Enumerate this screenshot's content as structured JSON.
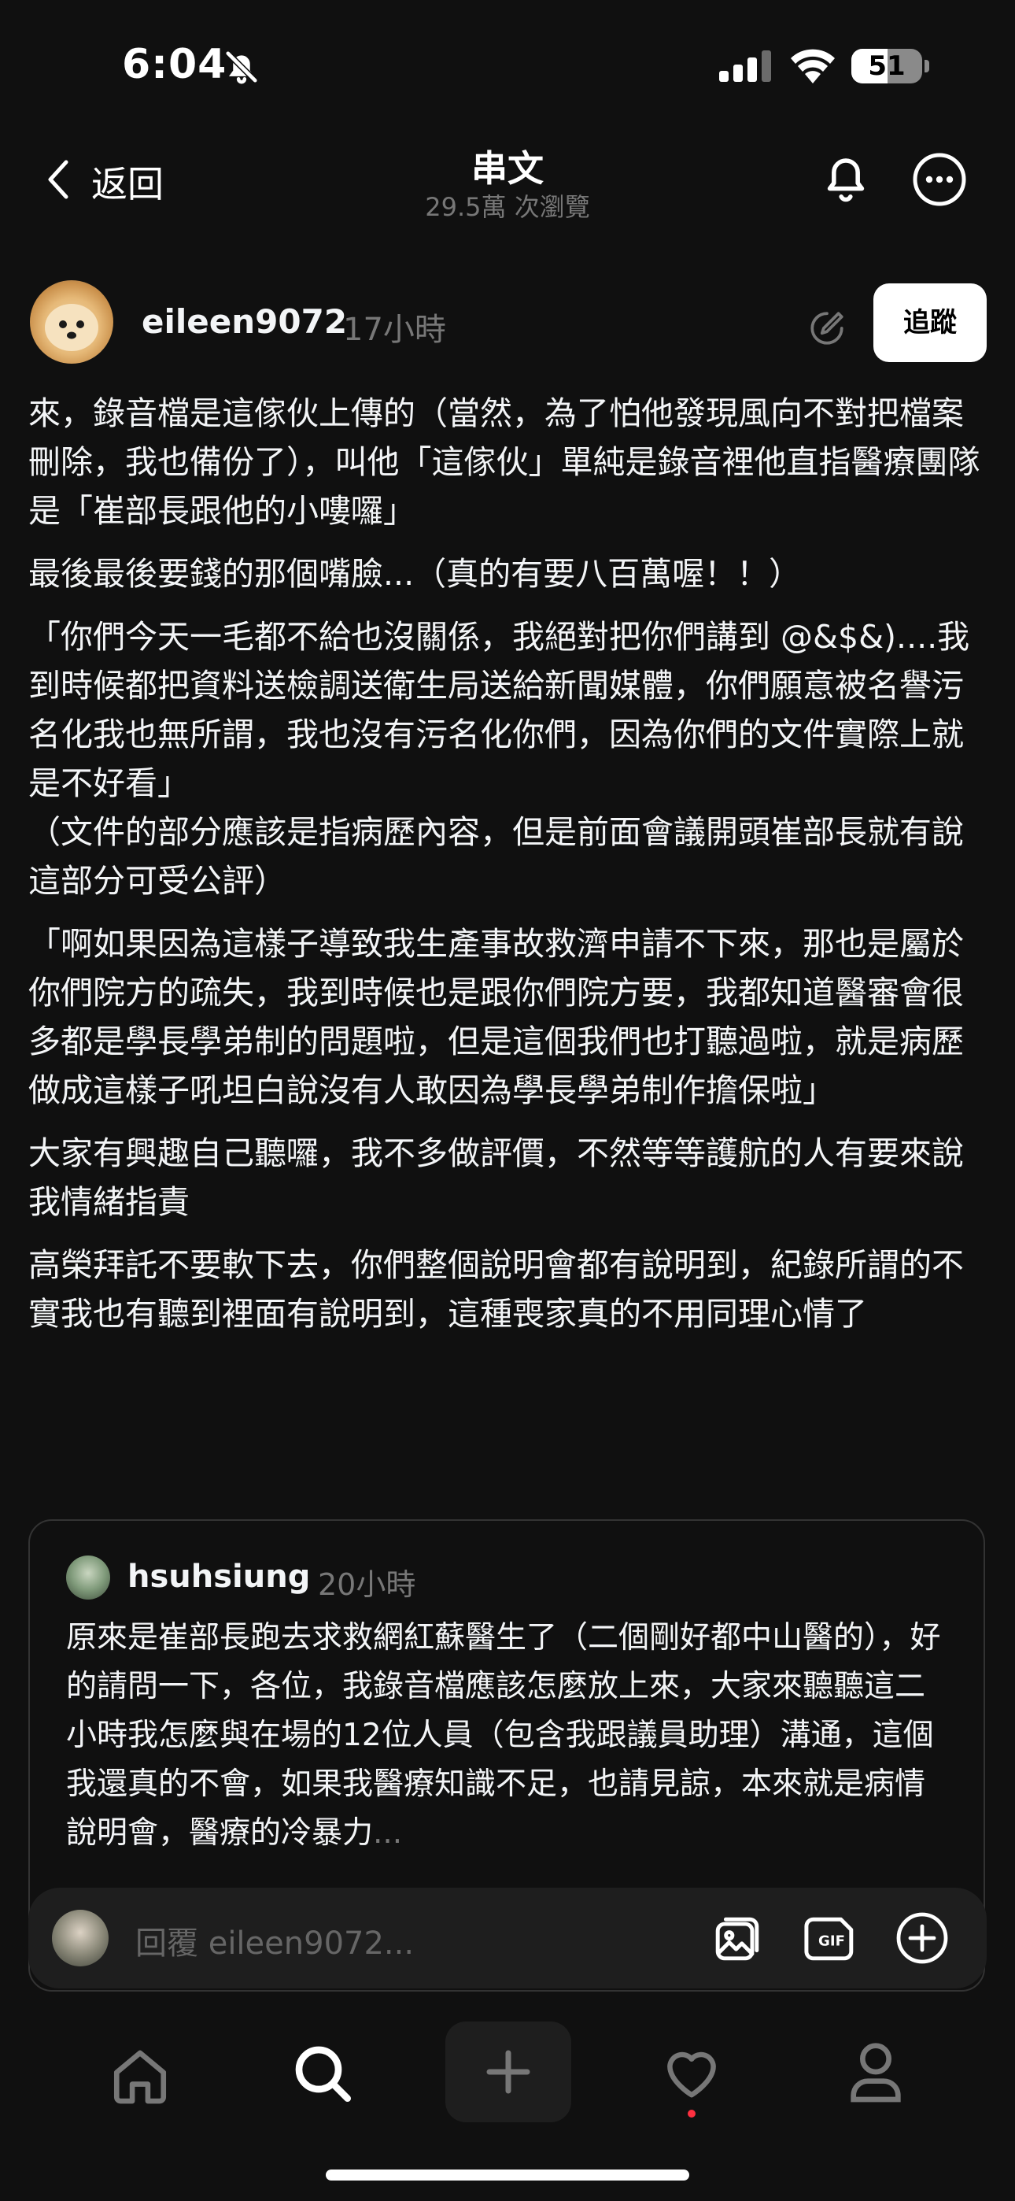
{
  "status_bar": {
    "time": "6:04",
    "battery": "51",
    "battery_fraction": 0.51,
    "icons": [
      "bell-slash-icon",
      "signal-icon",
      "wifi-icon",
      "battery-icon"
    ]
  },
  "header": {
    "back_label": "返回",
    "title": "串文",
    "subtitle": "29.5萬 次瀏覽",
    "icons": [
      "chevron-left-icon",
      "bell-icon",
      "more-icon"
    ]
  },
  "post": {
    "username": "eileen9072",
    "time": "17小時",
    "follow_label": "追蹤",
    "paragraphs": [
      "來，錄音檔是這傢伙上傳的（當然，為了怕他發現風向不對把檔案刪除，我也備份了），叫他「這傢伙」單純是錄音裡他直指醫療團隊是「崔部長跟他的小嘍囉」",
      "最後最後要錢的那個嘴臉...（真的有要八百萬喔！！）",
      "「你們今天一毛都不給也沒關係，我絕對把你們講到 @&$&)....我到時候都把資料送檢調送衛生局送給新聞媒體，你們願意被名譽污名化我也無所謂，我也沒有污名化你們，因為你們的文件實際上就是不好看」\n（文件的部分應該是指病歷內容，但是前面會議開頭崔部長就有說這部分可受公評）",
      "「啊如果因為這樣子導致我生產事故救濟申請不下來，那也是屬於你們院方的疏失，我到時候也是跟你們院方要，我都知道醫審會很多都是學長學弟制的問題啦，但是這個我們也打聽過啦，就是病歷做成這樣子吼坦白說沒有人敢因為學長學弟制作擔保啦」",
      "大家有興趣自己聽囉，我不多做評價，不然等等護航的人有要來說我情緒指責",
      "高榮拜託不要軟下去，你們整個說明會都有說明到，紀錄所謂的不實我也有聽到裡面有說明到，這種喪家真的不用同理心情了"
    ]
  },
  "quoted_post": {
    "username": "hsuhsiung",
    "time": "20小時",
    "text": "原來是崔部長跑去求救網紅蘇醫生了（二個剛好都中山醫的），好的請問一下，各位，我錄音檔應該怎麼放上來，大家來聽聽這二小時我怎麼與在場的12位人員（包含我跟議員助理）溝通，這個我還真的不會，如果我醫療知識不足，也請見諒，本來就是病情說明會，醫療的冷暴力",
    "ellipsis": "..."
  },
  "reply_bar": {
    "placeholder": "回覆 eileen9072...",
    "gif_label": "GIF",
    "icons": [
      "image-icon",
      "gif-icon",
      "plus-circle-icon"
    ]
  },
  "tab_bar": {
    "icons": [
      "home-icon",
      "search-icon",
      "plus-icon",
      "heart-icon",
      "profile-icon"
    ],
    "accent_color": "#ff3040"
  }
}
